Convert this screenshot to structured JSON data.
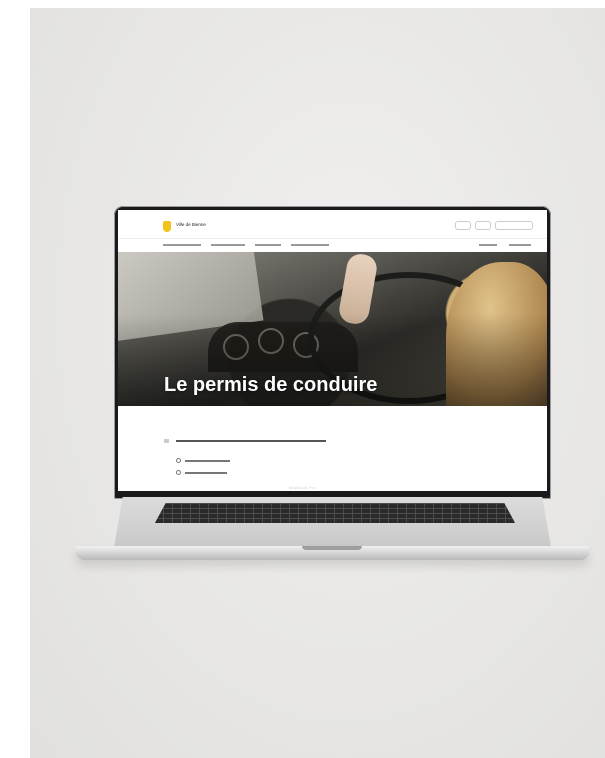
{
  "screen": {
    "site_name": "Ville de Bienne",
    "hero_title": "Le permis de conduire",
    "device_label": "MacBook Pro"
  },
  "colors": {
    "logo_yellow": "#f0c419",
    "hero_text": "#ffffff"
  }
}
